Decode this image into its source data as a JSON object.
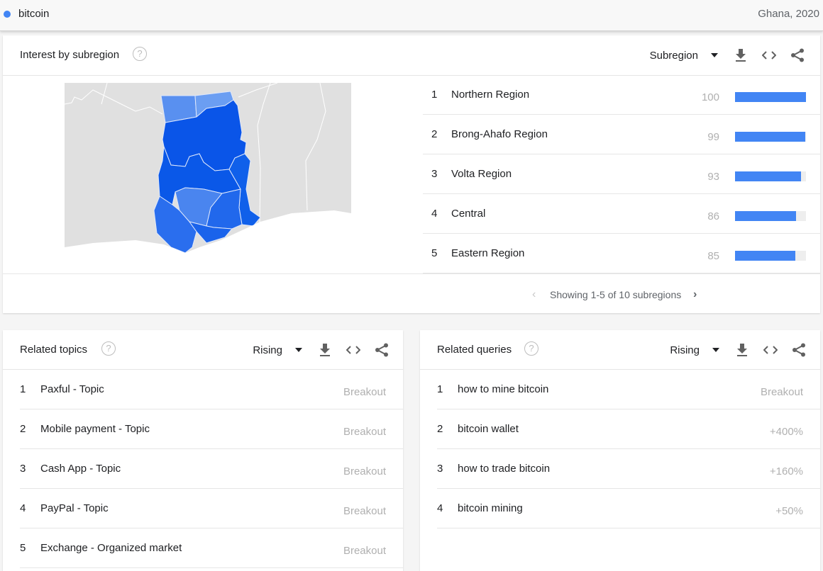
{
  "term": {
    "label": "bitcoin",
    "color": "#4285f4",
    "meta": "Ghana, 2020"
  },
  "subregion": {
    "title": "Interest by subregion",
    "help": "?",
    "select_label": "Subregion",
    "regions": [
      {
        "rank": "1",
        "name": "Northern Region",
        "value": "100",
        "pct": 100
      },
      {
        "rank": "2",
        "name": "Brong-Ahafo Region",
        "value": "99",
        "pct": 99
      },
      {
        "rank": "3",
        "name": "Volta Region",
        "value": "93",
        "pct": 93
      },
      {
        "rank": "4",
        "name": "Central",
        "value": "86",
        "pct": 86
      },
      {
        "rank": "5",
        "name": "Eastern Region",
        "value": "85",
        "pct": 85
      }
    ],
    "pager": {
      "prev": "‹",
      "text": "Showing 1-5 of 10 subregions",
      "next": "›"
    }
  },
  "topics": {
    "title": "Related topics",
    "help": "?",
    "select_label": "Rising",
    "items": [
      {
        "rank": "1",
        "name": "Paxful - Topic",
        "value": "Breakout"
      },
      {
        "rank": "2",
        "name": "Mobile payment - Topic",
        "value": "Breakout"
      },
      {
        "rank": "3",
        "name": "Cash App - Topic",
        "value": "Breakout"
      },
      {
        "rank": "4",
        "name": "PayPal - Topic",
        "value": "Breakout"
      },
      {
        "rank": "5",
        "name": "Exchange - Organized market",
        "value": "Breakout"
      }
    ]
  },
  "queries": {
    "title": "Related queries",
    "help": "?",
    "select_label": "Rising",
    "items": [
      {
        "rank": "1",
        "name": "how to mine bitcoin",
        "value": "Breakout"
      },
      {
        "rank": "2",
        "name": "bitcoin wallet",
        "value": "+400%"
      },
      {
        "rank": "3",
        "name": "how to trade bitcoin",
        "value": "+160%"
      },
      {
        "rank": "4",
        "name": "bitcoin mining",
        "value": "+50%"
      }
    ]
  },
  "icons": {
    "download": "download-icon",
    "embed": "embed-icon",
    "share": "share-icon"
  }
}
